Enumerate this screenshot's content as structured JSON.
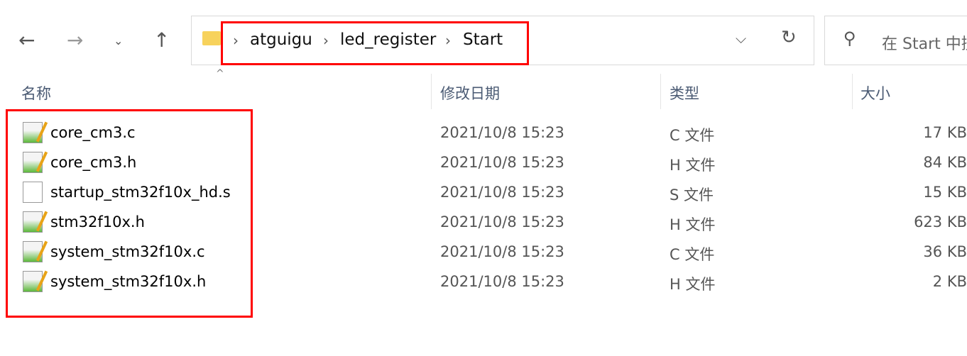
{
  "nav": {
    "back": "back",
    "forward": "forward",
    "recent": "recent-locations",
    "up": "up"
  },
  "breadcrumb": [
    "atguigu",
    "led_register",
    "Start"
  ],
  "search": {
    "placeholder": "在 Start 中搜索"
  },
  "columns": {
    "name": "名称",
    "date": "修改日期",
    "type": "类型",
    "size": "大小"
  },
  "files": [
    {
      "name": "core_cm3.c",
      "date": "2021/10/8 15:23",
      "type": "C 文件",
      "size": "17 KB",
      "icon": "source-file-icon"
    },
    {
      "name": "core_cm3.h",
      "date": "2021/10/8 15:23",
      "type": "H 文件",
      "size": "84 KB",
      "icon": "source-file-icon"
    },
    {
      "name": "startup_stm32f10x_hd.s",
      "date": "2021/10/8 15:23",
      "type": "S 文件",
      "size": "15 KB",
      "icon": "blank-file-icon"
    },
    {
      "name": "stm32f10x.h",
      "date": "2021/10/8 15:23",
      "type": "H 文件",
      "size": "623 KB",
      "icon": "source-file-icon"
    },
    {
      "name": "system_stm32f10x.c",
      "date": "2021/10/8 15:23",
      "type": "C 文件",
      "size": "36 KB",
      "icon": "source-file-icon"
    },
    {
      "name": "system_stm32f10x.h",
      "date": "2021/10/8 15:23",
      "type": "H 文件",
      "size": "2 KB",
      "icon": "source-file-icon"
    }
  ],
  "highlight_color": "#ff0000"
}
